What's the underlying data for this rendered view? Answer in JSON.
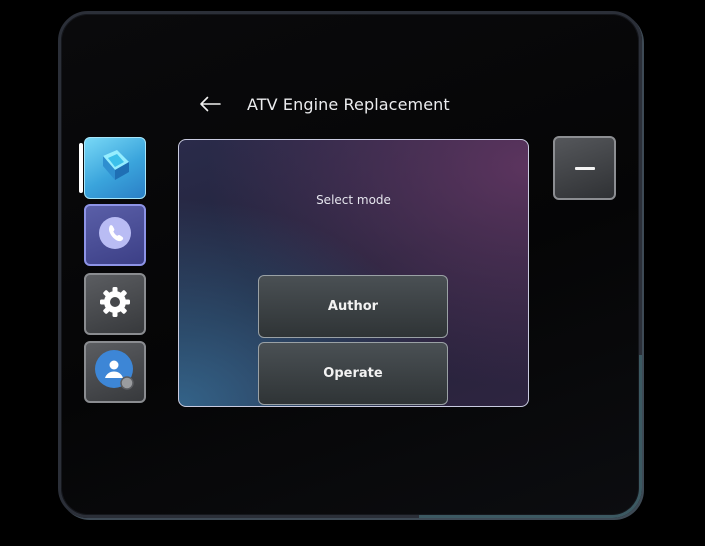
{
  "window": {
    "title": "ATV Engine Replacement"
  },
  "header": {
    "back_icon": "arrow-left-icon"
  },
  "rail": {
    "items": [
      {
        "name": "app",
        "icon": "guides-app-icon",
        "active": true,
        "color": "#3aa4dc"
      },
      {
        "name": "call",
        "icon": "phone-call-icon",
        "active": false,
        "color": "#3c3f86"
      },
      {
        "name": "settings",
        "icon": "gear-icon",
        "active": false,
        "color": "#37393c"
      },
      {
        "name": "profile",
        "icon": "person-icon",
        "active": false,
        "color": "#37393c"
      }
    ]
  },
  "dialog": {
    "prompt": "Select mode",
    "buttons": [
      {
        "label": "Author"
      },
      {
        "label": "Operate"
      }
    ]
  },
  "minimize": {
    "icon": "minimize-icon"
  },
  "colors": {
    "accent": "#2b7fc6",
    "dialog_border": "#c9cbe0",
    "text": "#ecedef"
  }
}
